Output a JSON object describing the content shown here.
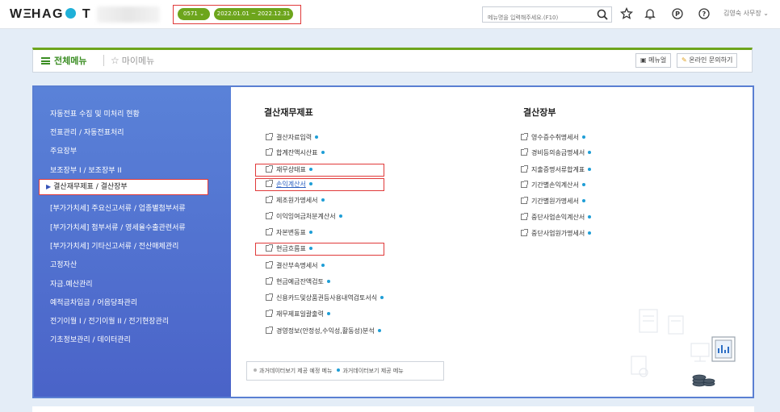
{
  "topbar": {
    "logo": "WEHAGO T",
    "company_code": "0571",
    "date_range": "2022.01.01 ~ 2022.12.31",
    "search_placeholder": "메뉴명을 입력해주세요.(F10)",
    "user": "김영숙 사무장"
  },
  "menubar": {
    "tab_all": "전체메뉴",
    "tab_my": "마이메뉴",
    "manual_button": "메뉴얼",
    "inquiry_button": "온라인 문의하기"
  },
  "sidebar": {
    "items": [
      "자동전표 수집 및 미처리 현황",
      "전표관리 / 자동전표처리",
      "주요장부",
      "보조장부 I / 보조장부 II",
      "결산재무제표 / 결산장부",
      "[부가가치세] 주요신고서류 / 업종별첨부서류",
      "[부가가치세] 첨부서류 / 영세율수출관련서류",
      "[부가가치세] 기타신고서류 / 전산매체관리",
      "고정자산",
      "자금.예산관리",
      "예적금차입금 / 어음당좌관리",
      "전기이월 I / 전기이월 II / 전기현장관리",
      "기초정보관리 / 데이터관리"
    ]
  },
  "col1": {
    "title": "결산재무제표",
    "items": [
      "결산자료입력",
      "합계잔액시산표",
      "재무상태표",
      "손익계산서",
      "제조원가명세서",
      "이익잉여금처분계산서",
      "자본변동표",
      "현금흐름표",
      "결산부속명세서",
      "현금예금잔액검토",
      "신용카드및상품권등사용내역검토서식",
      "재무제표일괄출력",
      "경영정보(안정성,수익성,활동성)분석"
    ]
  },
  "col2": {
    "title": "결산장부",
    "items": [
      "영수증수취명세서",
      "경비등의송금명세서",
      "지출증명서류합계표",
      "기간별손익계산서",
      "기간별원가명세서",
      "중단사업손익계산서",
      "중단사업원가명세서"
    ]
  },
  "legend": {
    "planned": "과거데이터보기 제공 예정 메뉴",
    "provided": "과거데이터보기 제공 메뉴"
  },
  "colors": {
    "accent_green": "#6da51c",
    "sidebar_blue": "#4f6fd0",
    "highlight_red": "#e03a3a",
    "dot_blue": "#1f9ed6"
  }
}
